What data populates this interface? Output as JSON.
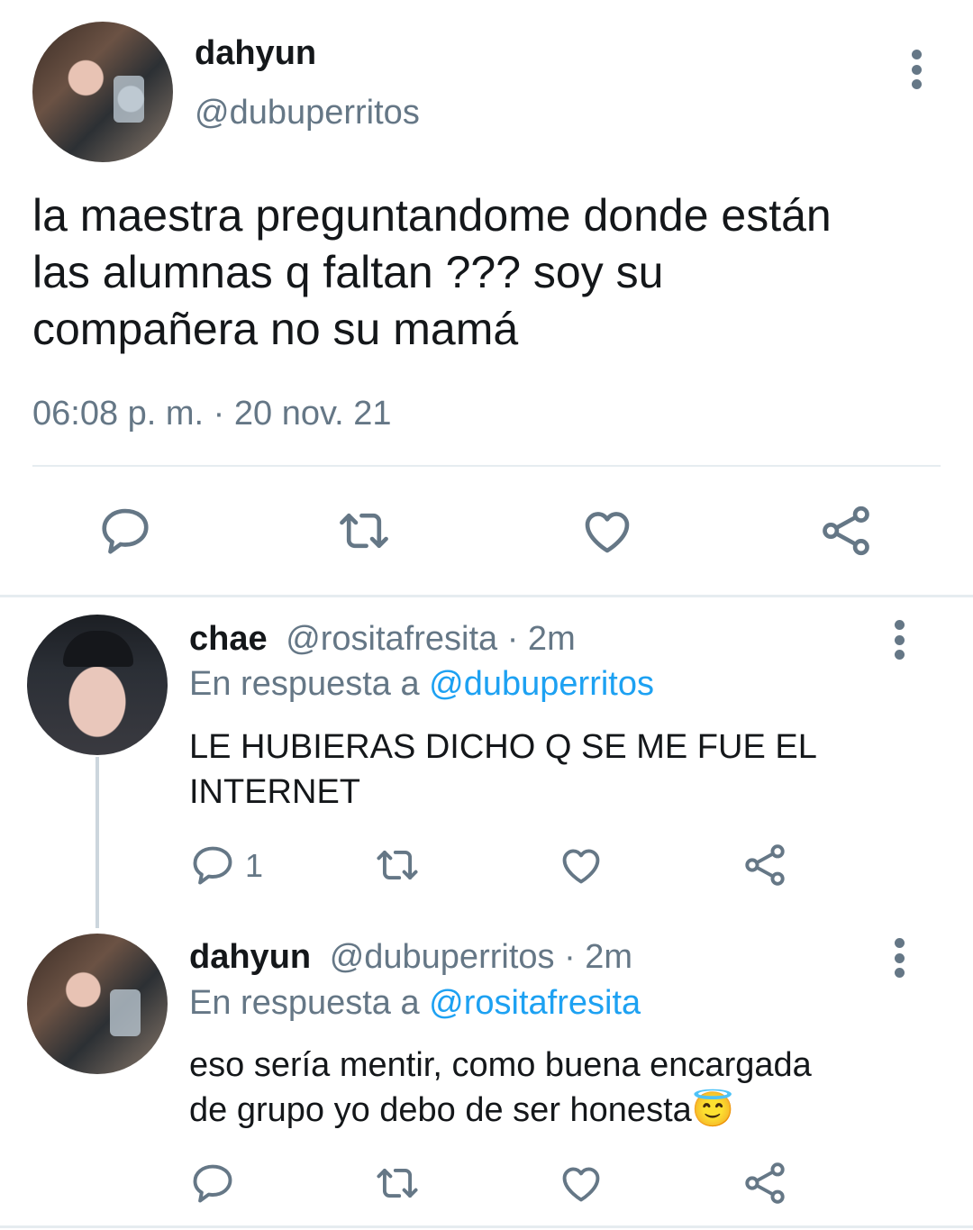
{
  "main_tweet": {
    "name": "dahyun",
    "handle": "@dubuperritos",
    "text_line1": "la maestra preguntandome donde están",
    "text_line2": "las alumnas q faltan ??? soy su",
    "text_line3": "compañera no su mamá",
    "timestamp": "06:08 p. m. · 20 nov. 21"
  },
  "reply1": {
    "name": "chae",
    "meta": "@rositafresita · 2m",
    "reply_prefix": "En respuesta a",
    "reply_to": "@dubuperritos",
    "text_line1": "LE HUBIERAS DICHO Q SE ME FUE EL",
    "text_line2": "INTERNET",
    "reply_count": "1"
  },
  "reply2": {
    "name": "dahyun",
    "meta": "@dubuperritos · 2m",
    "reply_prefix": "En respuesta a",
    "reply_to": "@rositafresita",
    "text_line1": "eso sería mentir, como buena encargada",
    "text_line2": "de grupo yo debo de ser honesta",
    "emoji": "😇"
  },
  "icons": [
    "reply-icon",
    "retweet-icon",
    "like-icon",
    "share-icon",
    "more-icon"
  ],
  "colors": {
    "text": "#14171a",
    "secondary": "#657786",
    "link": "#1da1f2",
    "divider": "#e6ecf0"
  }
}
